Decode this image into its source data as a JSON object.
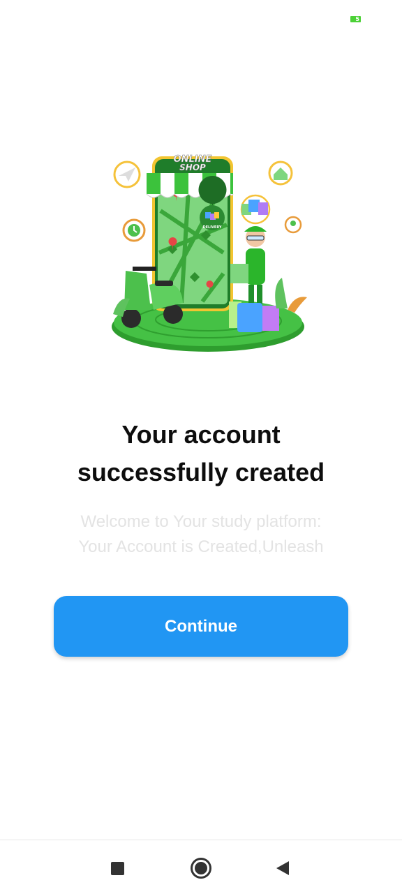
{
  "status_bar": {
    "battery_level": "5",
    "battery_color": "#4cd137"
  },
  "illustration": {
    "sign_line1": "ONLINE",
    "sign_line2": "SHOP",
    "badge_text": "DELIVERY"
  },
  "content": {
    "title_line1": "Your account",
    "title_line2": "successfully created",
    "subtitle_line1": "Welcome to Your study platform:",
    "subtitle_line2": "Your Account is Created,Unleash",
    "continue_label": "Continue"
  },
  "colors": {
    "accent": "#2196f3",
    "brand_green": "#3cc23c",
    "title_text": "#0d0d0d",
    "subtitle_text": "#e3e3e3"
  },
  "nav_bar": {
    "recents_icon": "square-icon",
    "home_icon": "circle-icon",
    "back_icon": "triangle-back-icon"
  }
}
